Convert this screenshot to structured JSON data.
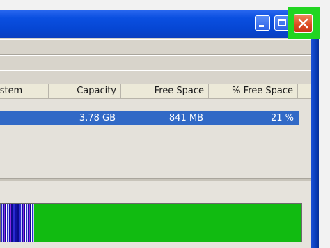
{
  "table": {
    "columns": [
      "ystem",
      "Capacity",
      "Free Space",
      "% Free Space"
    ],
    "rows": [
      {
        "system": "",
        "capacity": "3.78 GB",
        "free_space": "841 MB",
        "pct_free": "21 %"
      }
    ]
  },
  "usage": {
    "used_fraction": 0.11,
    "free_fraction": 0.89,
    "used_color": "#2a2ad0",
    "free_color": "#11bb11"
  },
  "colors": {
    "titlebar": "#0646d3",
    "close_button": "#dc4a1f",
    "close_highlight": "#21d521",
    "selected_row": "#3169c6"
  },
  "icons": {
    "minimize": "minimize-icon",
    "maximize": "maximize-icon",
    "close": "close-icon"
  }
}
